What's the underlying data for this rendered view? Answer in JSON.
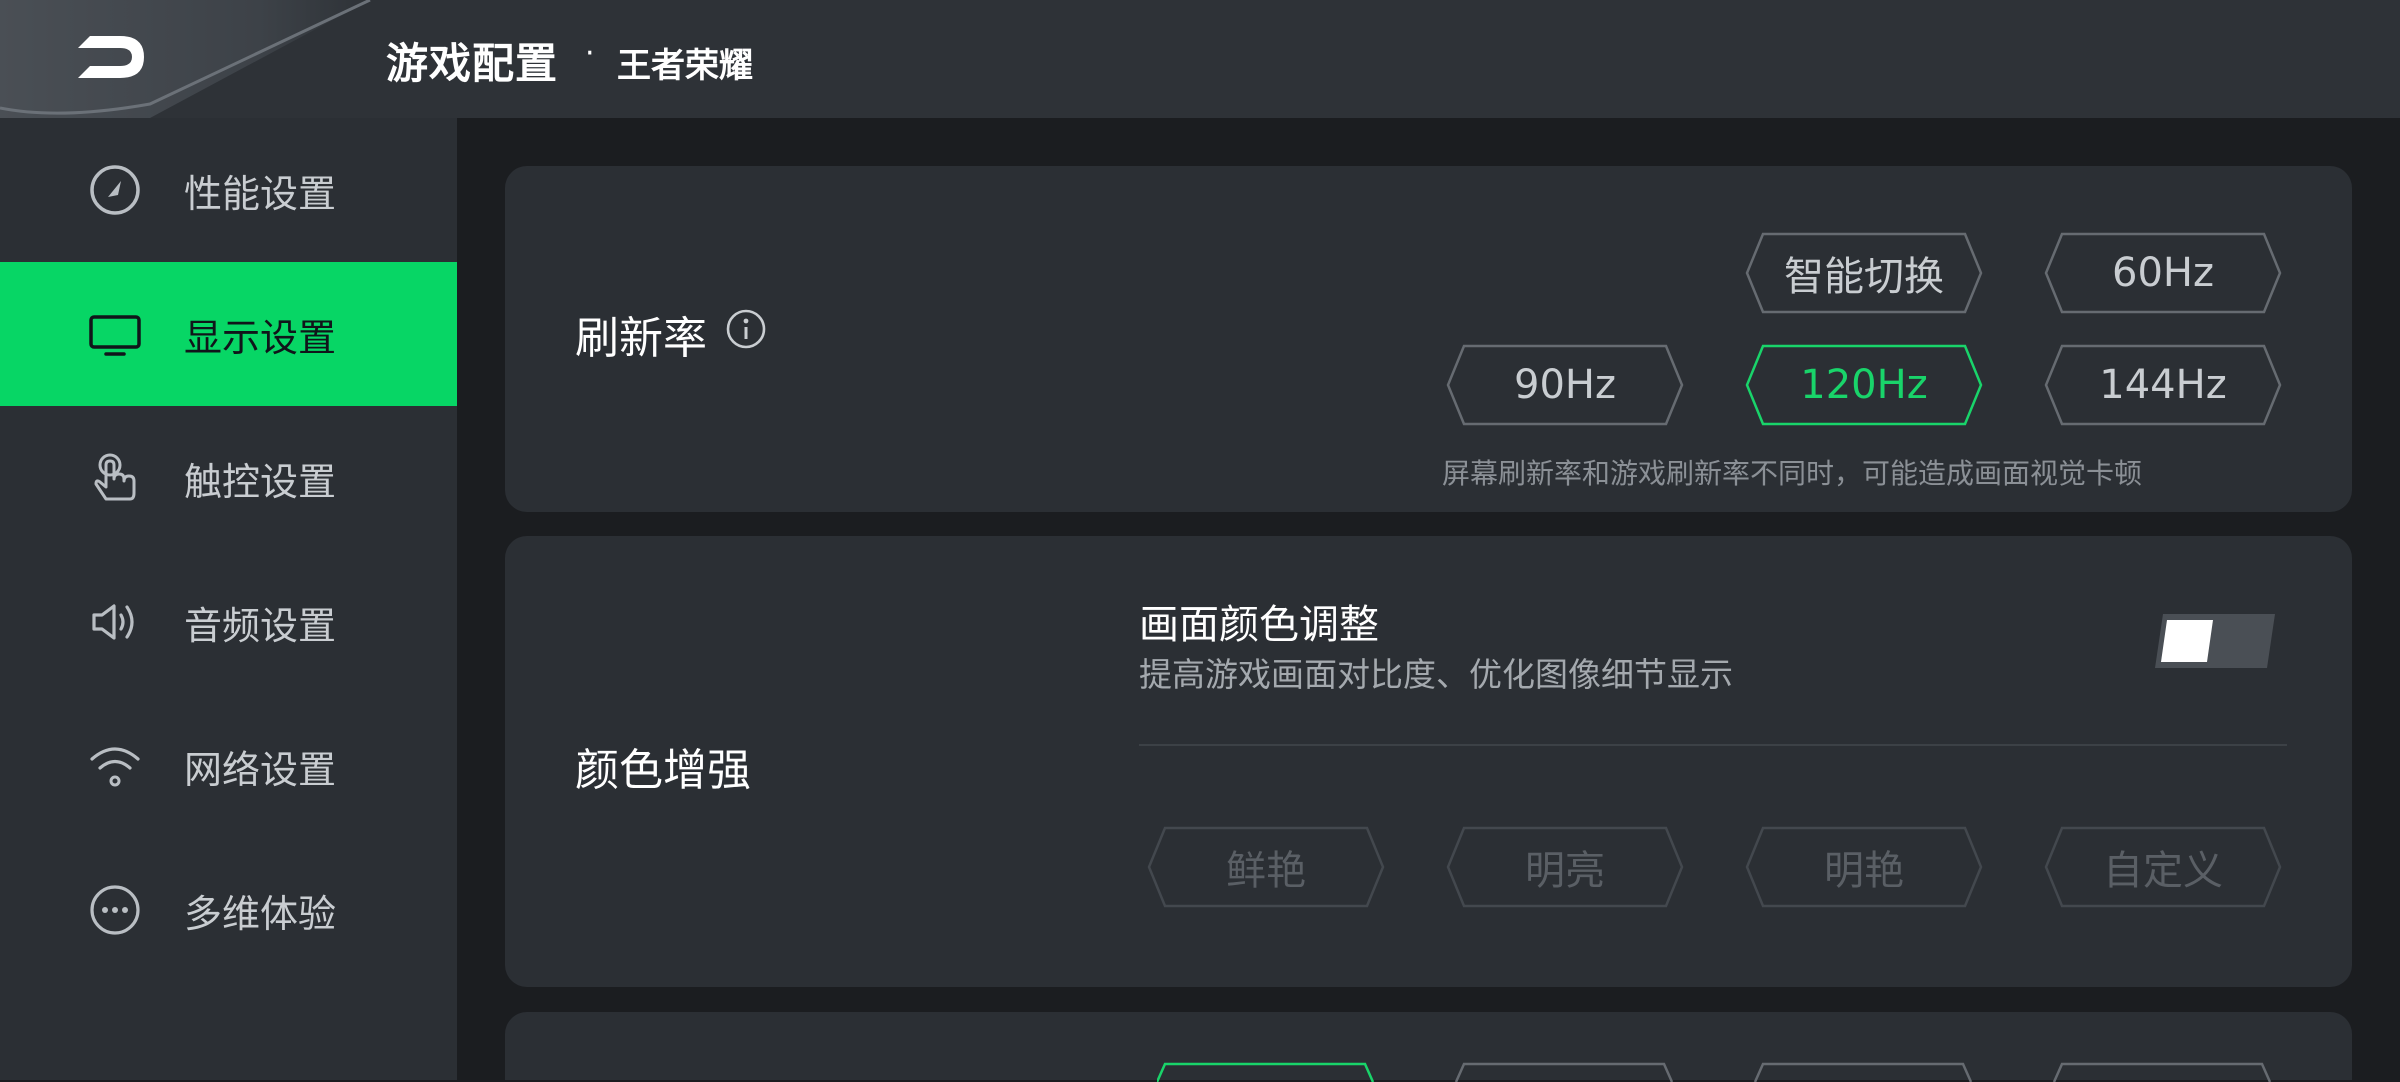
{
  "header": {
    "title": "游戏配置",
    "separator": "·",
    "game": "王者荣耀",
    "logo_icon": "brand-logo-icon"
  },
  "sidebar": {
    "items": [
      {
        "label": "性能设置",
        "icon": "speedometer-icon",
        "active": false
      },
      {
        "label": "显示设置",
        "icon": "monitor-icon",
        "active": true
      },
      {
        "label": "触控设置",
        "icon": "touch-hand-icon",
        "active": false
      },
      {
        "label": "音频设置",
        "icon": "speaker-icon",
        "active": false
      },
      {
        "label": "网络设置",
        "icon": "wifi-icon",
        "active": false
      },
      {
        "label": "多维体验",
        "icon": "more-dots-icon",
        "active": false
      }
    ]
  },
  "refresh": {
    "title": "刷新率",
    "options": [
      "智能切换",
      "60Hz",
      "90Hz",
      "120Hz",
      "144Hz"
    ],
    "selected": "120Hz",
    "hint": "屏幕刷新率和游戏刷新率不同时，可能造成画面视觉卡顿"
  },
  "color": {
    "title": "颜色增强",
    "adjust_title": "画面颜色调整",
    "adjust_desc": "提高游戏画面对比度、优化图像细节显示",
    "toggle_on": false,
    "modes": [
      "鲜艳",
      "明亮",
      "明艳",
      "自定义"
    ]
  },
  "colors": {
    "accent": "#07d665",
    "selected_text": "#19d46a",
    "card": "#2b2f34",
    "background": "#1b1d20"
  }
}
